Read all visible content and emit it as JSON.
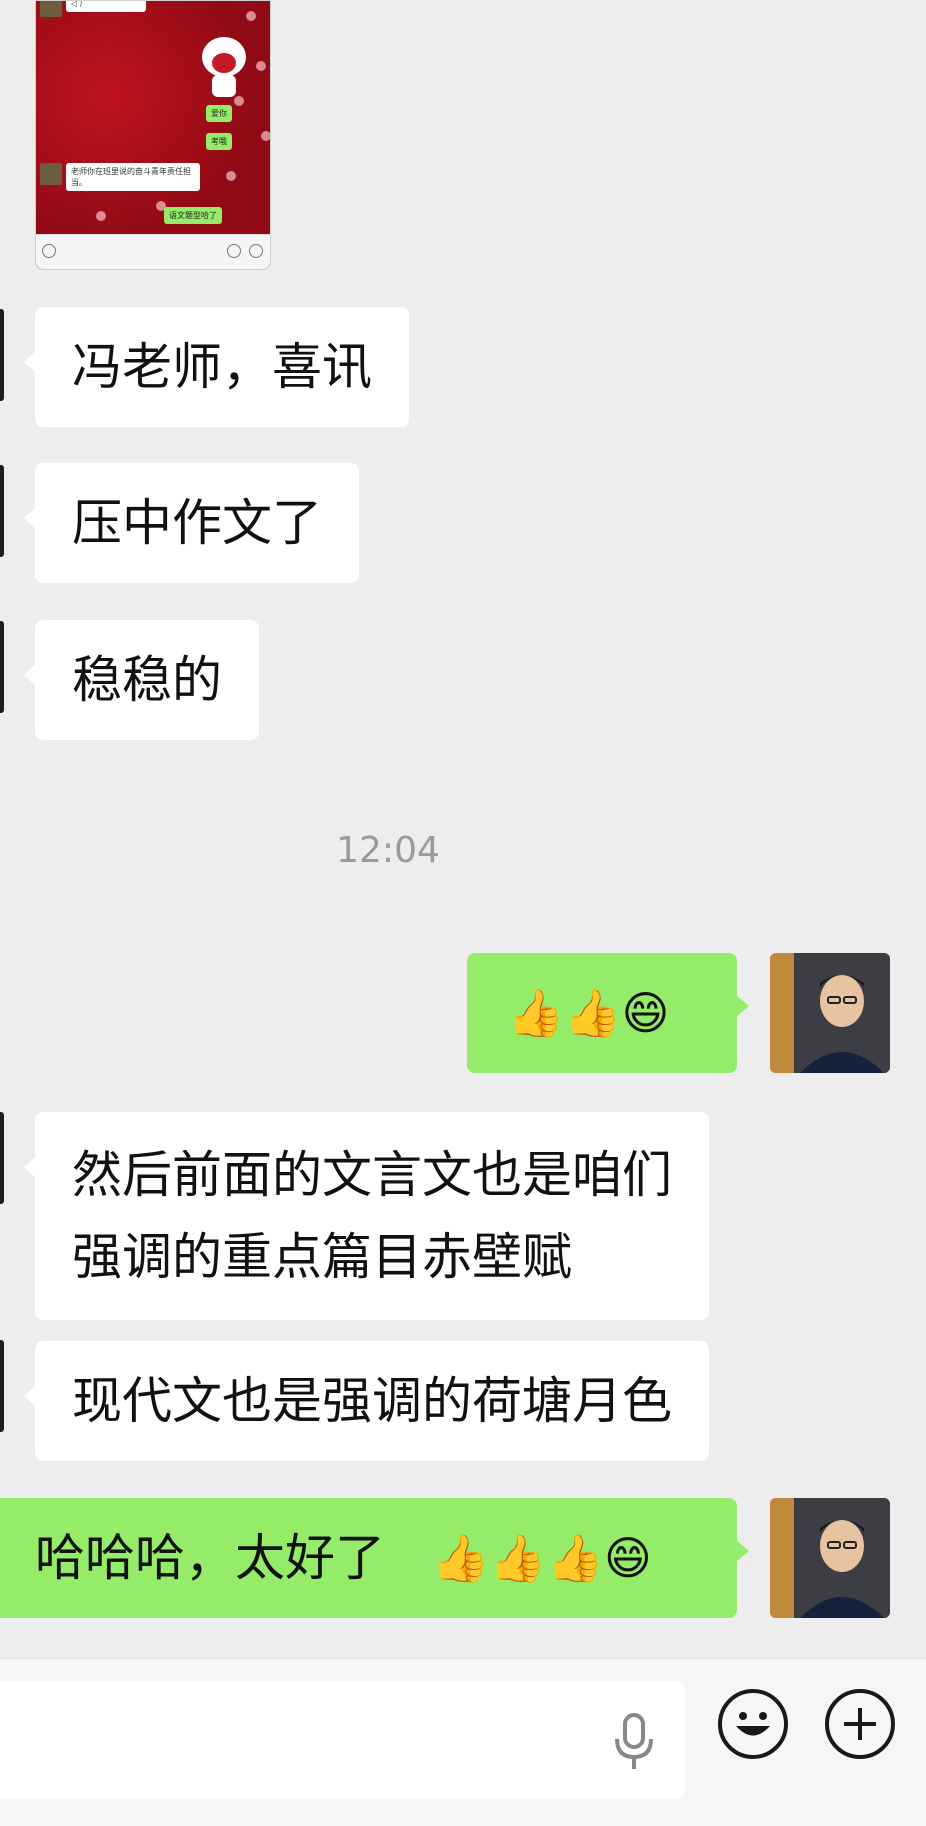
{
  "image_message": {
    "mini_top_text": "◁ 广",
    "mini_green_1": "爱你",
    "mini_green_2": "考哦",
    "mini_white_text": "老师你在班里说的奋斗青年责任担当。",
    "mini_green_3": "语文题型哈了"
  },
  "messages": {
    "m1": "冯老师，喜讯",
    "m2": "压中作文了",
    "m3": "稳稳的",
    "timestamp": "12:04",
    "r1_emoji": "👍👍😄",
    "m4_line1": "然后前面的文言文也是咱们",
    "m4_line2": "强调的重点篇目赤壁赋",
    "m5": "现代文也是强调的荷塘月色",
    "r2_text": "哈哈哈，太好了",
    "r2_emoji": "👍👍👍😄"
  },
  "input_bar": {
    "placeholder": "",
    "icons": [
      "microphone-icon",
      "emoji-icon",
      "plus-icon"
    ]
  },
  "colors": {
    "background": "#ededed",
    "sent_bubble": "#95ec69",
    "received_bubble": "#ffffff"
  }
}
